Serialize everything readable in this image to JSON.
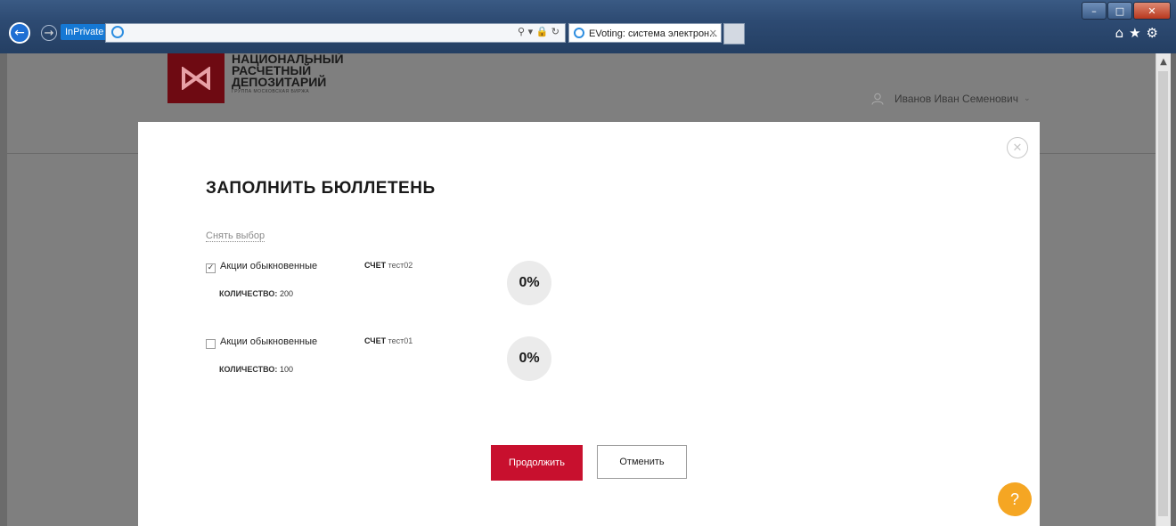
{
  "browser": {
    "inprivate_label": "InPrivate",
    "tab_title": "EVoting: система электрон...",
    "tab_close": "✕",
    "addr_controls": "⚲ ▾ 🔒 ↻",
    "win_min": "–",
    "win_max": "□",
    "win_close": "✕",
    "tools": "⌂★⚙"
  },
  "header": {
    "logo_line1": "НАЦИОНАЛЬНЫЙ",
    "logo_line2": "РАСЧЕТНЫЙ",
    "logo_line3": "ДЕПОЗИТАРИЙ",
    "logo_sub": "ГРУППА МОСКОВСКАЯ БИРЖА",
    "user_name": "Иванов Иван Семенович",
    "user_chevron": "⌄"
  },
  "modal": {
    "title": "ЗАПОЛНИТЬ БЮЛЛЕТЕНЬ",
    "clear_selection": "Снять выбор",
    "close_icon": "✕",
    "rows": [
      {
        "checked": "✓",
        "name": "Акции обыкновенные",
        "account_label": "СЧЕТ",
        "account_value": "тест02",
        "qty_label": "КОЛИЧЕСТВО:",
        "qty_value": "200",
        "percent": "0%"
      },
      {
        "checked": "",
        "name": "Акции обыкновенные",
        "account_label": "СЧЕТ",
        "account_value": "тест01",
        "qty_label": "КОЛИЧЕСТВО:",
        "qty_value": "100",
        "percent": "0%"
      }
    ],
    "continue_label": "Продолжить",
    "cancel_label": "Отменить"
  },
  "help": {
    "label": "?"
  },
  "colors": {
    "accent": "#c8102e",
    "help": "#f5a623",
    "logo": "#6e0a12"
  }
}
